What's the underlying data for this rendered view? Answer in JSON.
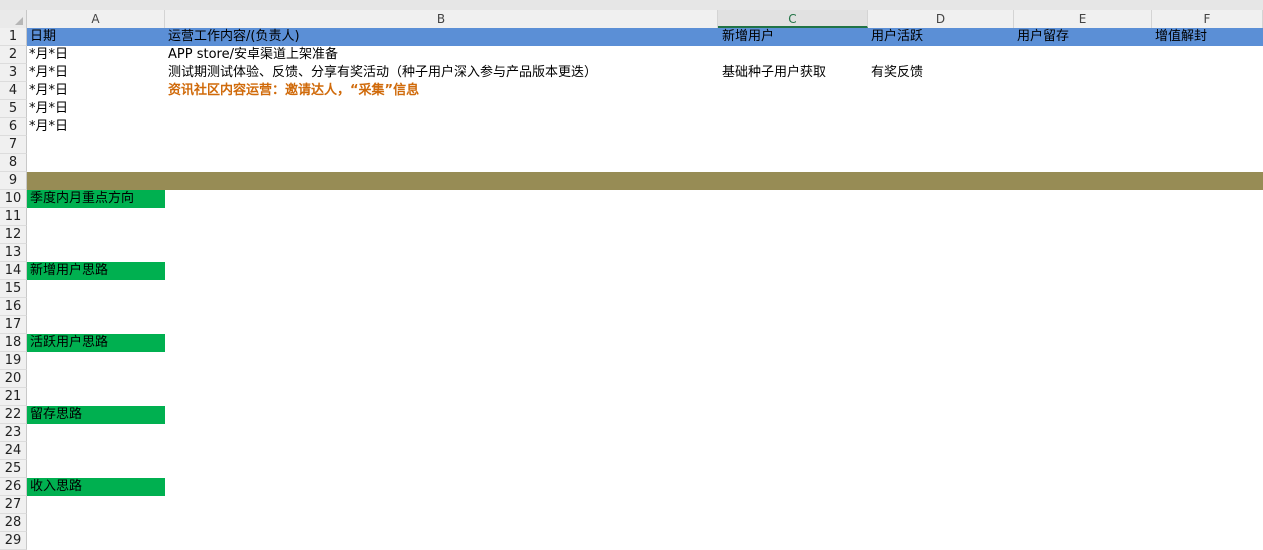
{
  "columns": [
    "A",
    "B",
    "C",
    "D",
    "E",
    "F"
  ],
  "selected_column": "C",
  "row_numbers": [
    "1",
    "2",
    "3",
    "4",
    "5",
    "6",
    "7",
    "8",
    "9",
    "10",
    "11",
    "12",
    "13",
    "14",
    "15",
    "16",
    "17",
    "18",
    "19",
    "20",
    "21",
    "22",
    "23",
    "24",
    "25",
    "26",
    "27",
    "28",
    "29"
  ],
  "header_row": {
    "date": "日期",
    "content": "运营工作内容/(负责人)",
    "new_users": "新增用户",
    "active_users": "用户活跃",
    "retention": "用户留存",
    "value_added": "增值解封"
  },
  "rows": {
    "r2": {
      "date": "*月*日",
      "content": "APP store/安卓渠道上架准备"
    },
    "r3": {
      "date": "*月*日",
      "content": "测试期测试体验、反馈、分享有奖活动（种子用户深入参与产品版本更迭）",
      "new_users": "基础种子用户获取",
      "active_users": "有奖反馈"
    },
    "r4": {
      "date": "*月*日",
      "content": "资讯社区内容运营：邀请达人，“采集”信息"
    },
    "r5": {
      "date": "*月*日"
    },
    "r6": {
      "date": "*月*日"
    }
  },
  "sections": {
    "r10": "季度内月重点方向",
    "r14": "新增用户思路",
    "r18": "活跃用户思路",
    "r22": "留存思路",
    "r26": "收入思路"
  },
  "colors": {
    "header_blue": "#5b8fd6",
    "divider_olive": "#978c55",
    "section_green": "#00b050",
    "highlight_orange": "#d06a0a"
  }
}
